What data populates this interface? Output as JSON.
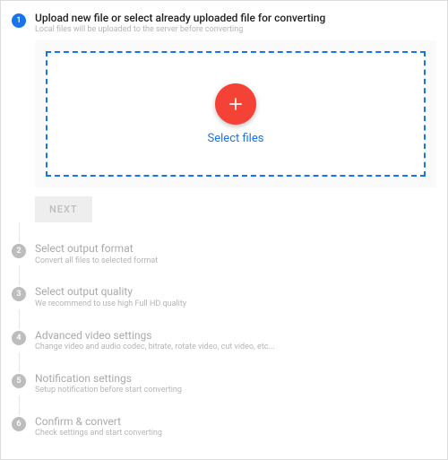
{
  "steps": [
    {
      "num": "1",
      "title": "Upload new file or select already uploaded file for converting",
      "desc": "Local files will be uploaded to the server before converting",
      "active": true
    },
    {
      "num": "2",
      "title": "Select output format",
      "desc": "Convert all files to selected format",
      "active": false
    },
    {
      "num": "3",
      "title": "Select output quality",
      "desc": "We recommend to use high Full HD quality",
      "active": false
    },
    {
      "num": "4",
      "title": "Advanced video settings",
      "desc": "Change video and audio codec, bitrate, rotate video, cut video, etc...",
      "active": false
    },
    {
      "num": "5",
      "title": "Notification settings",
      "desc": "Setup notification before start converting",
      "active": false
    },
    {
      "num": "6",
      "title": "Confirm & convert",
      "desc": "Check settings and start converting",
      "active": false
    }
  ],
  "upload": {
    "select_label": "Select files"
  },
  "buttons": {
    "next": "NEXT"
  }
}
